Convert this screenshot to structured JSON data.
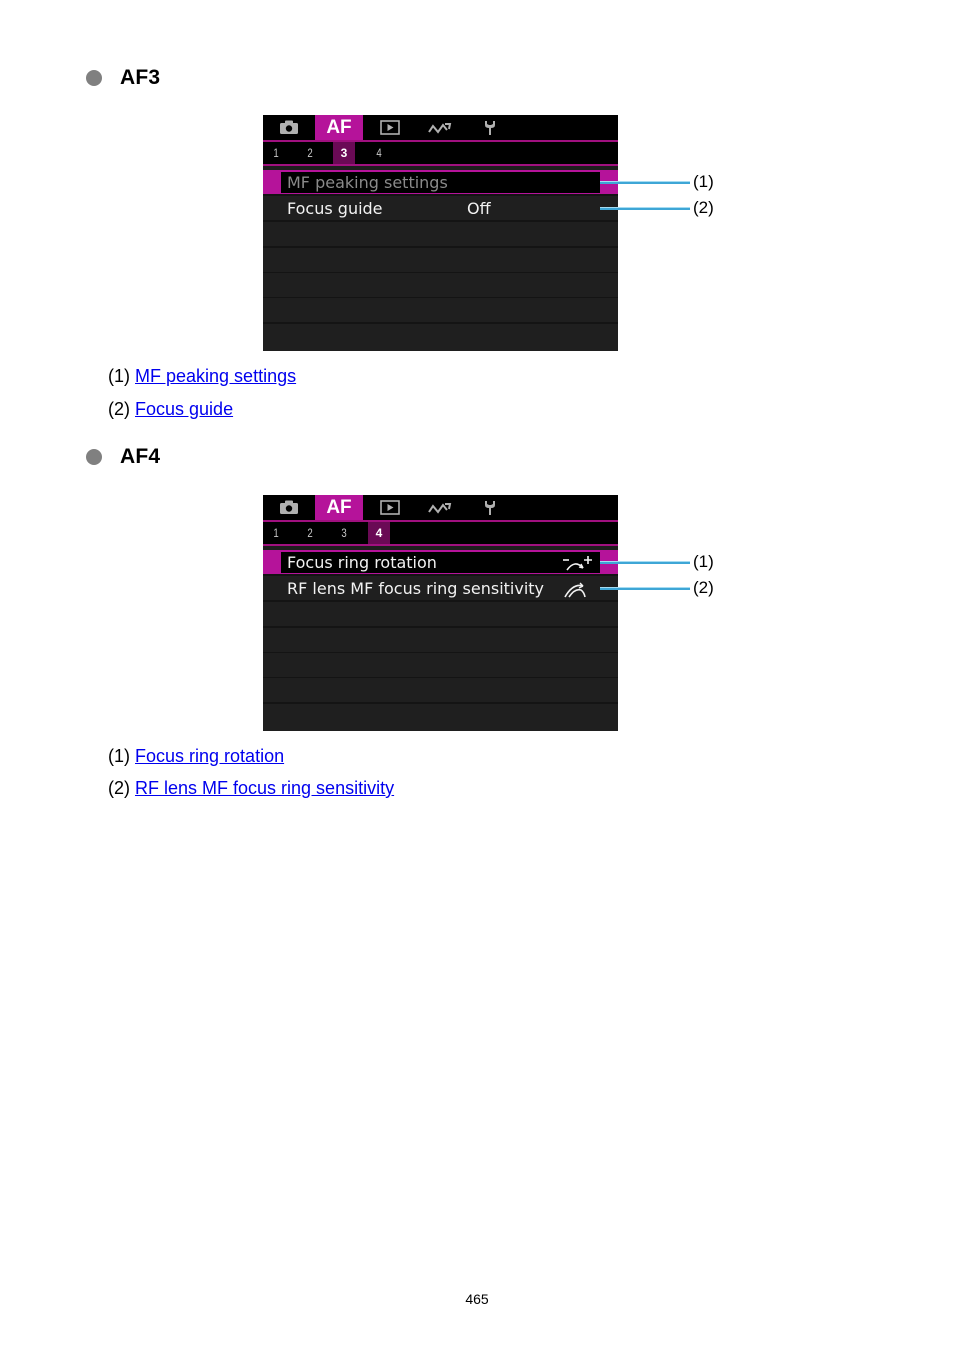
{
  "sections": [
    {
      "title": "AF3",
      "menu": {
        "tabs": [
          {
            "icon": "camera-icon"
          },
          {
            "label": "AF"
          },
          {
            "icon": "playback-icon"
          },
          {
            "icon": "wireless-icon"
          },
          {
            "icon": "wrench-icon"
          }
        ],
        "subtabs": [
          "1",
          "2",
          "3",
          "4"
        ],
        "active_subtab": "3",
        "rows": [
          {
            "label": "MF peaking settings",
            "value": "",
            "selected": true,
            "dim": true
          },
          {
            "label": "Focus guide",
            "value": "Off",
            "selected": false
          }
        ]
      },
      "callouts": [
        "(1)",
        "(2)"
      ],
      "refs": [
        {
          "num": "(1)",
          "link": "MF peaking settings"
        },
        {
          "num": "(2)",
          "link": "Focus guide"
        }
      ]
    },
    {
      "title": "AF4",
      "menu": {
        "tabs": [
          {
            "icon": "camera-icon"
          },
          {
            "label": "AF"
          },
          {
            "icon": "playback-icon"
          },
          {
            "icon": "wireless-icon"
          },
          {
            "icon": "wrench-icon"
          }
        ],
        "subtabs": [
          "1",
          "2",
          "3",
          "4"
        ],
        "active_subtab": "4",
        "rows": [
          {
            "label": "Focus ring rotation",
            "icon": "focus-ring-direction-icon",
            "selected": true
          },
          {
            "label": "RF lens MF focus ring sensitivity",
            "icon": "ring-sensitivity-icon",
            "selected": false
          }
        ]
      },
      "callouts": [
        "(1)",
        "(2)"
      ],
      "refs": [
        {
          "num": "(1)",
          "link": "Focus ring rotation"
        },
        {
          "num": "(2)",
          "link": "RF lens MF focus ring sensitivity"
        }
      ]
    }
  ],
  "colors": {
    "accent": "#b5139a",
    "link": "#0000ee",
    "callout": "#3ea6d6"
  },
  "page_number": "465"
}
